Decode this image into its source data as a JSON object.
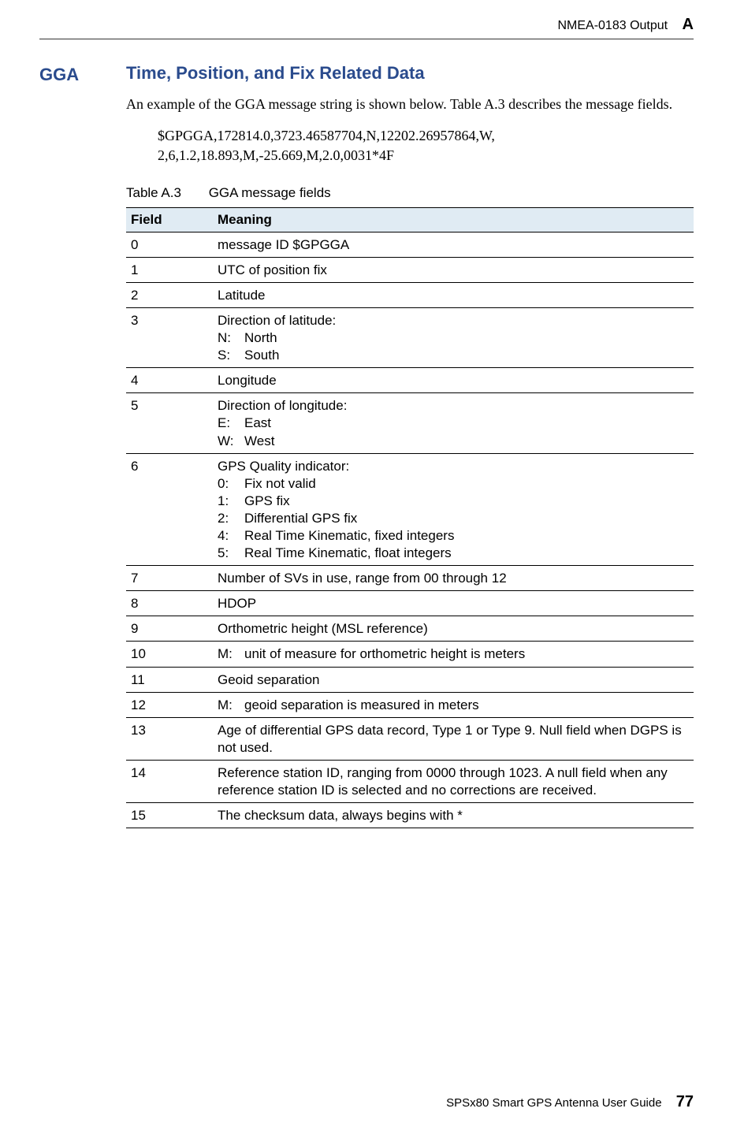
{
  "header": {
    "chapter_label": "NMEA-0183 Output",
    "chapter_letter": "A"
  },
  "section": {
    "tag": "GGA",
    "title": "Time, Position, and Fix Related Data",
    "intro": "An example of the GGA message string is shown below. Table A.3 describes the message fields.",
    "example_line1": "$GPGGA,172814.0,3723.46587704,N,12202.26957864,W,",
    "example_line2": "2,6,1.2,18.893,M,-25.669,M,2.0,0031*4F"
  },
  "table": {
    "label": "Table A.3",
    "title": "GGA message fields",
    "col_field": "Field",
    "col_meaning": "Meaning",
    "rows": [
      {
        "field": "0",
        "meaning": "message ID $GPGGA"
      },
      {
        "field": "1",
        "meaning": "UTC of position fix"
      },
      {
        "field": "2",
        "meaning": "Latitude"
      },
      {
        "field": "3",
        "meaning": "Direction of latitude:",
        "sub": [
          {
            "k": "N:",
            "v": "North"
          },
          {
            "k": "S:",
            "v": "South"
          }
        ]
      },
      {
        "field": "4",
        "meaning": "Longitude"
      },
      {
        "field": "5",
        "meaning": "Direction of longitude:",
        "sub": [
          {
            "k": "E:",
            "v": "East"
          },
          {
            "k": "W:",
            "v": "West"
          }
        ]
      },
      {
        "field": "6",
        "meaning": "GPS Quality indicator:",
        "sub": [
          {
            "k": "0:",
            "v": "Fix not valid"
          },
          {
            "k": "1:",
            "v": "GPS fix"
          },
          {
            "k": "2:",
            "v": "Differential GPS fix"
          },
          {
            "k": "4:",
            "v": "Real Time Kinematic, fixed integers"
          },
          {
            "k": "5:",
            "v": "Real Time Kinematic, float integers"
          }
        ]
      },
      {
        "field": "7",
        "meaning": "Number of SVs in use, range from 00 through 12"
      },
      {
        "field": "8",
        "meaning": "HDOP"
      },
      {
        "field": "9",
        "meaning": "Orthometric height (MSL reference)"
      },
      {
        "field": "10",
        "meaning_prefix": "M: ",
        "meaning": "unit of measure for orthometric height is meters"
      },
      {
        "field": "11",
        "meaning": "Geoid separation"
      },
      {
        "field": "12",
        "meaning_prefix": "M: ",
        "meaning": "geoid separation is measured in meters"
      },
      {
        "field": "13",
        "meaning": "Age of differential GPS data record, Type 1 or Type 9. Null field when DGPS is not used."
      },
      {
        "field": "14",
        "meaning": "Reference station ID, ranging from 0000 through 1023. A null field when any reference station ID is selected and no corrections are received."
      },
      {
        "field": "15",
        "meaning": "The checksum data, always begins with *"
      }
    ]
  },
  "footer": {
    "guide": "SPSx80 Smart GPS Antenna User Guide",
    "page": "77"
  }
}
